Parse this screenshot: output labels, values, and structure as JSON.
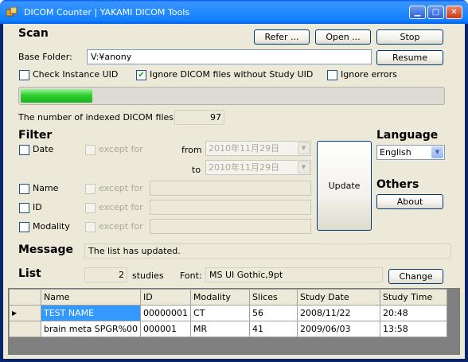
{
  "window": {
    "title": "DICOM Counter | YAKAMI DICOM Tools"
  },
  "scan": {
    "heading": "Scan",
    "refer_label": "Refer ...",
    "open_label": "Open ...",
    "stop_label": "Stop",
    "resume_label": "Resume",
    "base_folder_label": "Base Folder:",
    "base_folder_value": "V:¥anony",
    "check_instance_uid": {
      "label": "Check Instance UID",
      "checked": false
    },
    "ignore_no_study_uid": {
      "label": "Ignore DICOM files without Study UID",
      "checked": true
    },
    "ignore_errors": {
      "label": "Ignore errors",
      "checked": false
    },
    "progress_fraction": 0.17,
    "indexed_label": "The number of indexed DICOM files:",
    "indexed_count": "97"
  },
  "filter": {
    "heading": "Filter",
    "date_label": "Date",
    "except_for": "except for",
    "from_label": "from",
    "to_label": "to",
    "from_date": "2010年11月29日",
    "to_date": "2010年11月29日",
    "name_label": "Name",
    "id_label": "ID",
    "modality_label": "Modality",
    "update_label": "Update"
  },
  "language": {
    "heading": "Language",
    "selected": "English"
  },
  "others": {
    "heading": "Others",
    "about_label": "About"
  },
  "message": {
    "heading": "Message",
    "text": "The list has updated."
  },
  "list": {
    "heading": "List",
    "study_count": "2",
    "studies_label": "studies",
    "font_label": "Font:",
    "font_value": "MS UI Gothic,9pt",
    "change_label": "Change",
    "columns": [
      "Name",
      "ID",
      "Modality",
      "Slices",
      "Study Date",
      "Study Time"
    ],
    "rows": [
      [
        "TEST NAME",
        "00000001",
        "CT",
        "56",
        "2008/11/22",
        "20:48"
      ],
      [
        "brain meta SPGR%00",
        "000001",
        "MR",
        "41",
        "2009/06/03",
        "13:58"
      ]
    ]
  },
  "icons": {
    "current_row": "triangle-right-icon",
    "dropdown": "chevron-down-icon"
  }
}
